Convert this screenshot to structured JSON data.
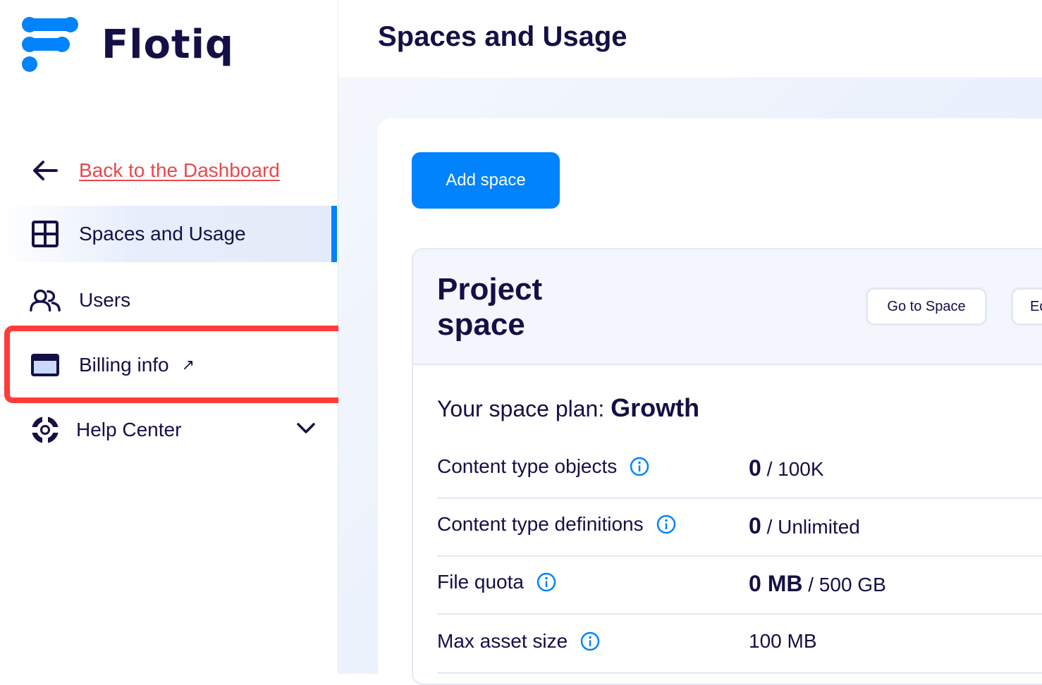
{
  "app": {
    "name": "Flotiq",
    "brand_color": "#0083fc",
    "text_color": "#141046",
    "link_color": "#e9484d",
    "highlight_color": "#ff3b3b"
  },
  "sidebar": {
    "back": {
      "label": "Back to the Dashboard",
      "icon": "arrow-left-icon"
    },
    "items": [
      {
        "label": "Spaces and Usage",
        "icon": "grid-icon",
        "active": true
      },
      {
        "label": "Users",
        "icon": "users-icon"
      },
      {
        "label": "Billing info",
        "icon": "credit-card-icon",
        "external": "↗",
        "highlighted": true
      },
      {
        "label": "Help Center",
        "icon": "lifebuoy-icon",
        "expandable": true
      }
    ]
  },
  "header": {
    "title": "Spaces and Usage"
  },
  "main": {
    "add_button": "Add space",
    "space": {
      "name": "Project space",
      "goto_button": "Go to Space",
      "edit_button": "Ed",
      "plan_prefix": "Your space plan:",
      "plan_name": "Growth",
      "usage": [
        {
          "label": "Content type objects",
          "used": "0",
          "limit": "/ 100K"
        },
        {
          "label": "Content type definitions",
          "used": "0",
          "limit": "/ Unlimited"
        },
        {
          "label": "File quota",
          "used": "0 MB",
          "limit": "/ 500 GB"
        },
        {
          "label": "Max asset size",
          "used": "",
          "limit": "100 MB"
        }
      ]
    }
  }
}
